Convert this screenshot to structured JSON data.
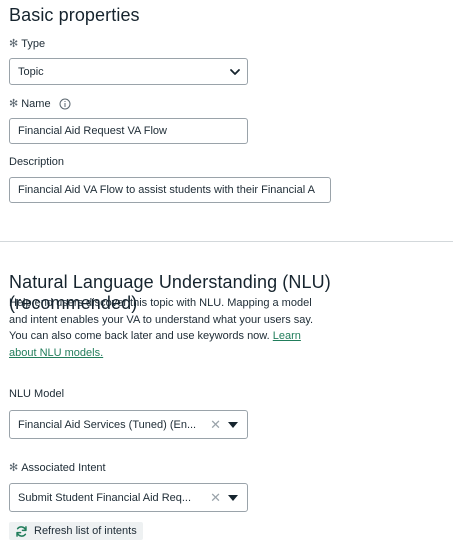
{
  "basic": {
    "title": "Basic properties",
    "type_label": "Type",
    "type_value": "Topic",
    "name_label": "Name",
    "name_value": "Financial Aid Request VA Flow",
    "description_label": "Description",
    "description_value": "Financial Aid VA Flow to assist students with their Financial A"
  },
  "nlu": {
    "title": "Natural Language Understanding (NLU) (recommended)",
    "help_line1": "Help end users discover this topic with NLU. Mapping a model",
    "help_line2": "and intent enables your VA to understand what your users say.",
    "help_line3": "You can also come back later and use keywords now.",
    "help_link1": "Learn",
    "help_link2": "about NLU models.",
    "model_label": "NLU Model",
    "model_value": "Financial Aid Services (Tuned) (En...",
    "intent_label": "Associated Intent",
    "intent_value": "Submit Student Financial Aid Req...",
    "refresh_label": "Refresh list of intents"
  },
  "icons": {
    "required": "asterisk-icon",
    "info": "info-icon",
    "chevron": "chevron-down-icon",
    "clear": "clear-x-icon",
    "caret": "caret-down-icon",
    "refresh": "refresh-icon"
  },
  "colors": {
    "link": "#217d5b",
    "border": "#9aa3aa",
    "text": "#1d2b35"
  }
}
